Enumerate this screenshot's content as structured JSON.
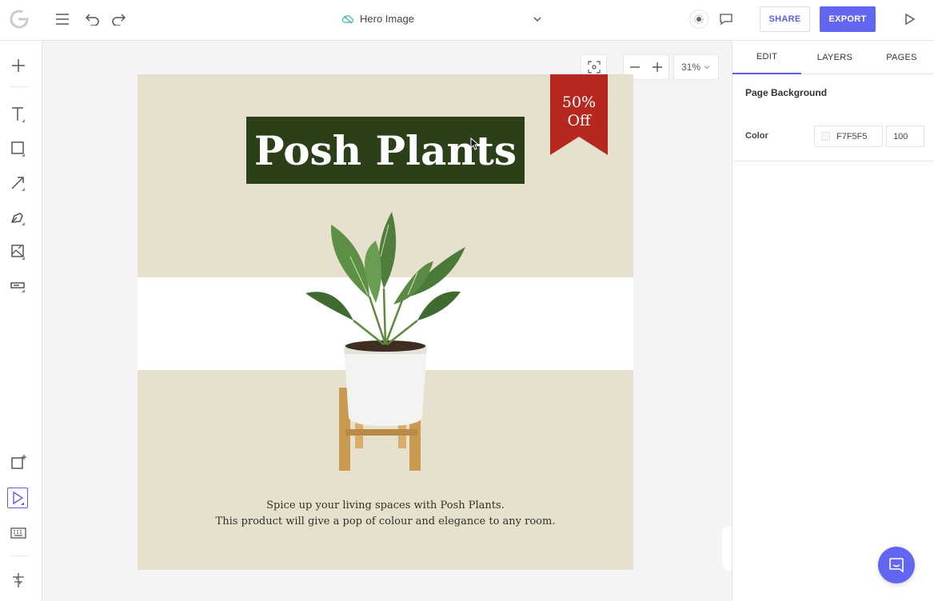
{
  "header": {
    "document_title": "Hero Image",
    "share_label": "SHARE",
    "export_label": "EXPORT"
  },
  "canvas": {
    "zoom_value": "31%",
    "design": {
      "title": "Posh Plants",
      "badge_line1": "50%",
      "badge_line2": "Off",
      "caption_line1": "Spice up your living spaces with Posh Plants.",
      "caption_line2": "This product will give a pop of colour and elegance to any room."
    }
  },
  "right_panel": {
    "tabs": [
      "EDIT",
      "LAYERS",
      "PAGES"
    ],
    "active_tab": "EDIT",
    "section_title": "Page Background",
    "color_label": "Color",
    "color_value": "F7F5F5",
    "opacity_value": "100"
  },
  "colors": {
    "accent": "#6366f1",
    "artboard_bg": "#e8e0cf",
    "title_box": "#2b4019",
    "ribbon": "#b5271f"
  }
}
